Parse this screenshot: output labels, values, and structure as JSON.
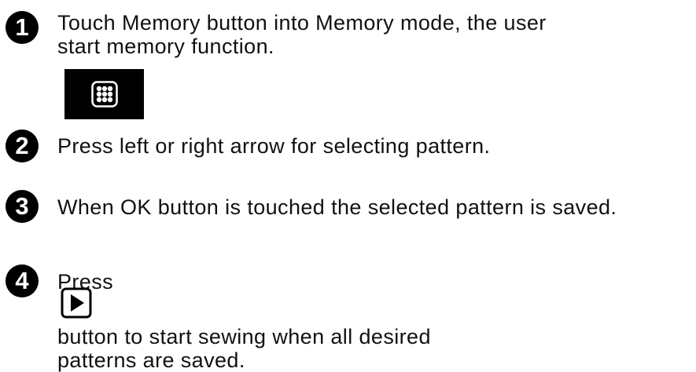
{
  "steps": [
    {
      "number": "1",
      "lines": [
        "Touch Memory button into Memory mode, the user",
        "start memory function."
      ],
      "icon": "memory-grid-icon"
    },
    {
      "number": "2",
      "lines": [
        "Press left or right arrow for selecting pattern."
      ]
    },
    {
      "number": "3",
      "lines": [
        "When OK button is touched the selected pattern is saved."
      ]
    },
    {
      "number": "4",
      "lines_before_icon": "Press",
      "lines_after_icon": "button to start sewing when all desired",
      "second_line": "patterns are saved.",
      "icon": "play-icon"
    }
  ],
  "colors": {
    "text": "#111111",
    "badge": "#000000",
    "button_bg": "#000000"
  }
}
